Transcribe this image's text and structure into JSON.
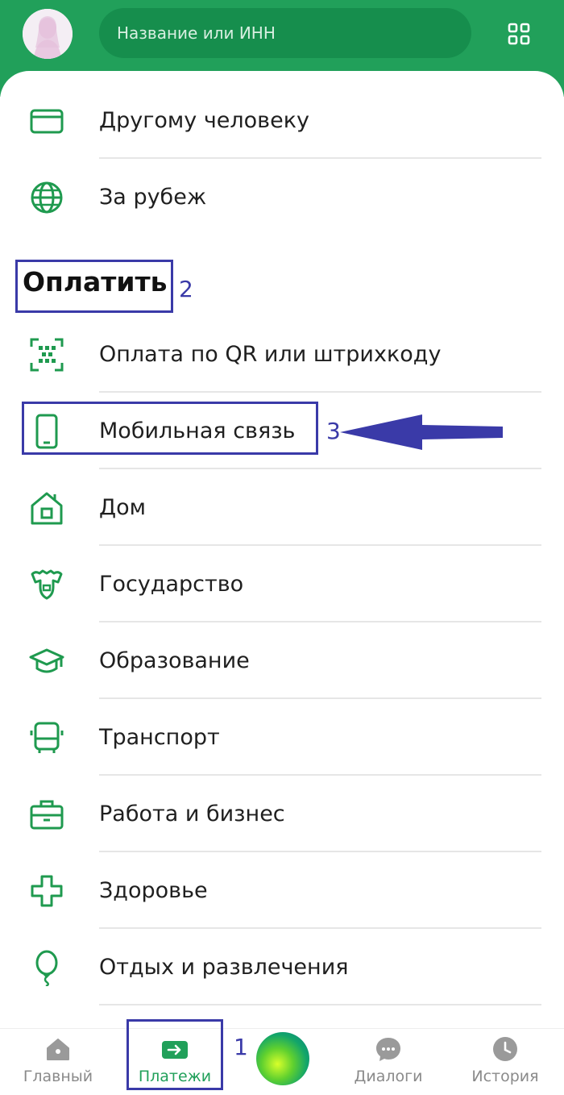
{
  "header": {
    "search_placeholder": "Название или ИНН",
    "avatar": "avatar",
    "grid_icon": "grid-icon"
  },
  "transfers": [
    {
      "label": "Другому человеку",
      "icon": "card-icon"
    },
    {
      "label": "За рубеж",
      "icon": "globe-icon"
    }
  ],
  "pay_section": {
    "title": "Оплатить",
    "items": [
      {
        "label": "Оплата по QR или штрихкоду",
        "icon": "qr-scan-icon"
      },
      {
        "label": "Мобильная связь",
        "icon": "phone-icon"
      },
      {
        "label": "Дом",
        "icon": "house-icon"
      },
      {
        "label": "Государство",
        "icon": "government-emblem-icon"
      },
      {
        "label": "Образование",
        "icon": "graduation-cap-icon"
      },
      {
        "label": "Транспорт",
        "icon": "bus-icon"
      },
      {
        "label": "Работа и бизнес",
        "icon": "briefcase-icon"
      },
      {
        "label": "Здоровье",
        "icon": "health-cross-icon"
      },
      {
        "label": "Отдых и развлечения",
        "icon": "balloon-icon"
      }
    ]
  },
  "annotations": {
    "n1": "1",
    "n2": "2",
    "n3": "3"
  },
  "bottom_nav": {
    "items": [
      {
        "label": "Главный",
        "icon": "home-icon",
        "active": false
      },
      {
        "label": "Платежи",
        "icon": "payments-arrow-icon",
        "active": true
      },
      {
        "label": "",
        "icon": "assistant-orb-icon",
        "active": false
      },
      {
        "label": "Диалоги",
        "icon": "chat-bubble-icon",
        "active": false
      },
      {
        "label": "История",
        "icon": "clock-icon",
        "active": false
      }
    ]
  },
  "colors": {
    "brand_green": "#21a05a",
    "search_green": "#168e4d",
    "icon_green": "#1f9a4f",
    "annotation_blue": "#3a3aa8"
  }
}
